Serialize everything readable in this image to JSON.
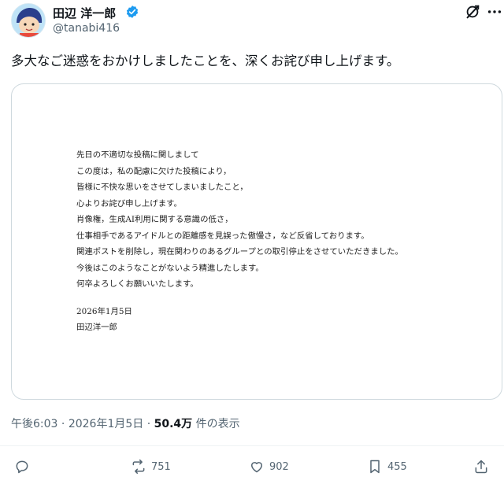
{
  "user": {
    "display_name": "田辺 洋一郎",
    "handle": "@tanabi416"
  },
  "tweet": {
    "text": "多大なご迷惑をおかけしましたことを、深くお詫び申し上げます。"
  },
  "letter": {
    "lines": [
      "先日の不適切な投稿に関しまして",
      "この度は，私の配慮に欠けた投稿により，",
      "皆様に不快な思いをさせてしまいましたこと，",
      "心よりお詫び申し上げます。",
      "肖像権，生成AI利用に関する意識の低さ，",
      "仕事相手であるアイドルとの距離感を見誤った傲慢さ，など反省しております。",
      "関連ポストを削除し，現在関わりのあるグループとの取引停止をさせていただきました。",
      "今後はこのようなことがないよう精進したします。",
      "何卒よろしくお願いいたします。"
    ],
    "date": "2026年1月5日",
    "signature": "田辺洋一郎"
  },
  "meta": {
    "time": "午後6:03",
    "date": "2026年1月5日",
    "views_count": "50.4万",
    "views_label": "件の表示"
  },
  "actions": {
    "retweets": "751",
    "likes": "902",
    "bookmarks": "455"
  },
  "colors": {
    "text": "#0f1419",
    "secondary": "#536471",
    "verified": "#1d9bf0",
    "border": "#cfd9de"
  },
  "icons": [
    "avatar",
    "verified-badge-icon",
    "grok-icon",
    "more-icon",
    "reply-icon",
    "retweet-icon",
    "like-icon",
    "bookmark-icon",
    "share-icon"
  ]
}
